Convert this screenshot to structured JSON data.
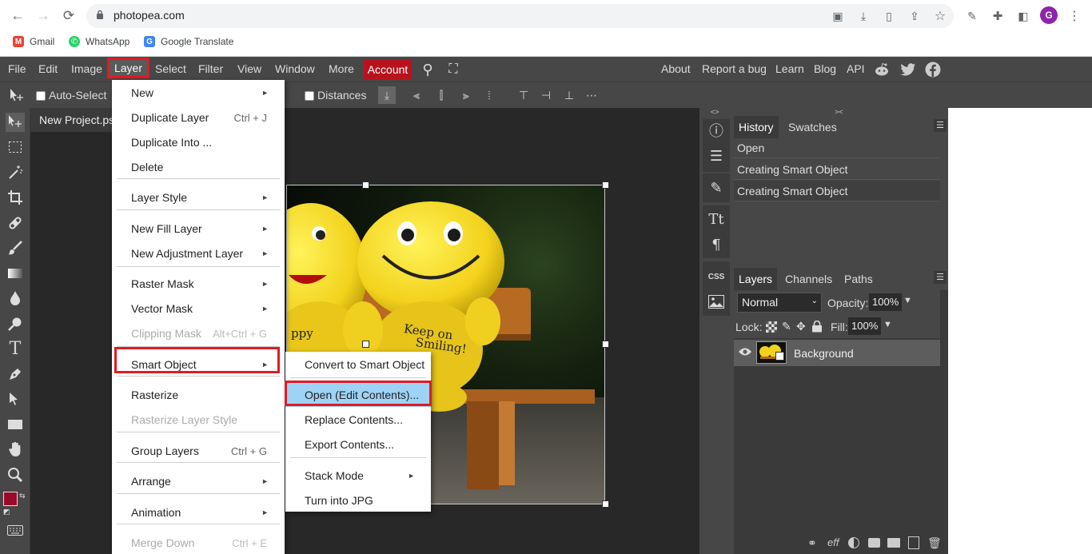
{
  "browser": {
    "url": "photopea.com",
    "bookmarks": [
      {
        "label": "Gmail",
        "icon": "gmail-icon",
        "color": "#ea4335"
      },
      {
        "label": "WhatsApp",
        "icon": "whatsapp-icon",
        "color": "#25d366"
      },
      {
        "label": "Google Translate",
        "icon": "google-translate-icon",
        "color": "#4285f4"
      }
    ],
    "profile_initial": "G",
    "profile_color": "#8e24aa"
  },
  "menubar": {
    "items": [
      "File",
      "Edit",
      "Image",
      "Layer",
      "Select",
      "Filter",
      "View",
      "Window",
      "More"
    ],
    "account": "Account",
    "right_links": [
      "About",
      "Report a bug",
      "Learn",
      "Blog",
      "API"
    ],
    "highlight_color": "#e01b24"
  },
  "options": {
    "auto_select": "Auto-Select",
    "distances": "Distances"
  },
  "document": {
    "tab_title": "New Project.psd"
  },
  "layer_menu": {
    "items": [
      {
        "label": "New",
        "shortcut": "",
        "submenu": true,
        "disabled": false
      },
      {
        "label": "Duplicate Layer",
        "shortcut": "Ctrl + J",
        "submenu": false,
        "disabled": false
      },
      {
        "label": "Duplicate Into ...",
        "shortcut": "",
        "submenu": false,
        "disabled": false
      },
      {
        "label": "Delete",
        "shortcut": "",
        "submenu": false,
        "disabled": false
      },
      {
        "label": "Layer Style",
        "shortcut": "",
        "submenu": true,
        "disabled": false
      },
      {
        "label": "New Fill Layer",
        "shortcut": "",
        "submenu": true,
        "disabled": false
      },
      {
        "label": "New Adjustment Layer",
        "shortcut": "",
        "submenu": true,
        "disabled": false
      },
      {
        "label": "Raster Mask",
        "shortcut": "",
        "submenu": true,
        "disabled": false
      },
      {
        "label": "Vector Mask",
        "shortcut": "",
        "submenu": true,
        "disabled": false
      },
      {
        "label": "Clipping Mask",
        "shortcut": "Alt+Ctrl + G",
        "submenu": false,
        "disabled": true
      },
      {
        "label": "Smart Object",
        "shortcut": "",
        "submenu": true,
        "disabled": false
      },
      {
        "label": "Rasterize",
        "shortcut": "",
        "submenu": false,
        "disabled": false
      },
      {
        "label": "Rasterize Layer Style",
        "shortcut": "",
        "submenu": false,
        "disabled": true
      },
      {
        "label": "Group Layers",
        "shortcut": "Ctrl + G",
        "submenu": false,
        "disabled": false
      },
      {
        "label": "Arrange",
        "shortcut": "",
        "submenu": true,
        "disabled": false
      },
      {
        "label": "Animation",
        "shortcut": "",
        "submenu": true,
        "disabled": false
      },
      {
        "label": "Merge Down",
        "shortcut": "Ctrl + E",
        "submenu": false,
        "disabled": true
      }
    ]
  },
  "smart_object_menu": {
    "items": [
      {
        "label": "Convert to Smart Object",
        "submenu": false,
        "highlighted": false
      },
      {
        "label": "Open (Edit Contents)...",
        "submenu": false,
        "highlighted": true
      },
      {
        "label": "Replace Contents...",
        "submenu": false,
        "highlighted": false
      },
      {
        "label": "Export Contents...",
        "submenu": false,
        "highlighted": false
      },
      {
        "label": "Stack Mode",
        "submenu": true,
        "highlighted": false
      },
      {
        "label": "Turn into JPG",
        "submenu": false,
        "highlighted": false
      }
    ],
    "highlight_bg": "#9fd3f5"
  },
  "history_panel": {
    "tabs": [
      "History",
      "Swatches"
    ],
    "entries": [
      "Open",
      "Creating Smart Object",
      "Creating Smart Object"
    ]
  },
  "layers_panel": {
    "tabs": [
      "Layers",
      "Channels",
      "Paths"
    ],
    "blend_mode": "Normal",
    "opacity_label": "Opacity:",
    "opacity_value": "100%",
    "lock_label": "Lock:",
    "fill_label": "Fill:",
    "fill_value": "100%",
    "layers": [
      {
        "name": "Background",
        "visible": true
      }
    ],
    "footer_icons": [
      "link-icon",
      "effects-icon",
      "adjustment-icon",
      "mask-icon",
      "folder-icon",
      "new-layer-icon",
      "trash-icon"
    ]
  },
  "colors": {
    "foreground": "#9b0a2a",
    "background": "#000000"
  }
}
